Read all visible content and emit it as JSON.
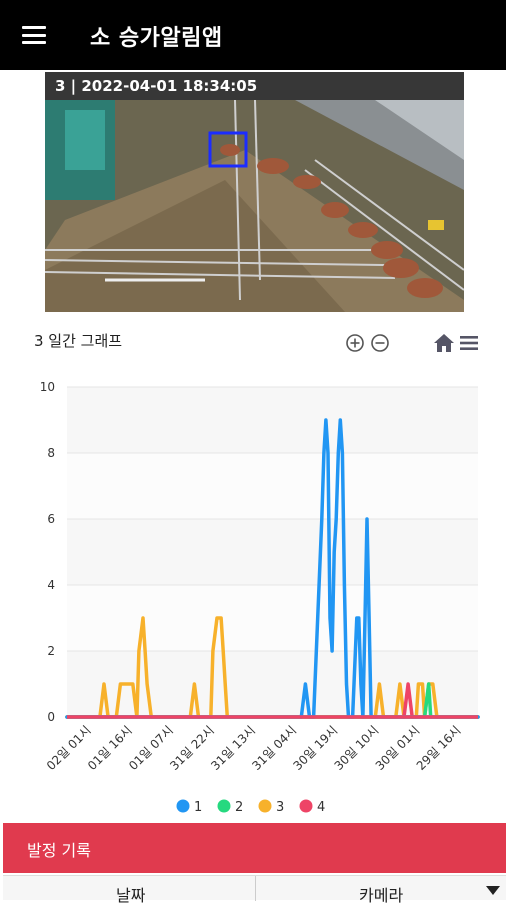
{
  "app": {
    "title": "소 승가알림앱"
  },
  "camera": {
    "header": "3 | 2022-04-01 18:34:05"
  },
  "graph": {
    "title": "3 일간 그래프"
  },
  "chart_data": {
    "type": "line",
    "title": "3 일간 그래프",
    "ylim": [
      0,
      10
    ],
    "yticks": [
      0,
      2,
      4,
      6,
      8,
      10
    ],
    "xticks": [
      "02일 01시",
      "01일 16시",
      "01일 07시",
      "31일 22시",
      "31일 13시",
      "31일 04시",
      "30일 19시",
      "30일 10시",
      "30일 01시",
      "29일 16시"
    ],
    "grid": true,
    "legend_position": "bottom",
    "series": [
      {
        "name": "1",
        "color": "#2196f3",
        "values": [
          [
            0,
            0
          ],
          [
            5.7,
            0
          ],
          [
            5.8,
            1
          ],
          [
            5.9,
            0
          ],
          [
            6.0,
            0
          ],
          [
            6.1,
            3
          ],
          [
            6.2,
            6
          ],
          [
            6.25,
            8
          ],
          [
            6.3,
            9
          ],
          [
            6.35,
            8
          ],
          [
            6.4,
            3
          ],
          [
            6.45,
            2
          ],
          [
            6.5,
            5
          ],
          [
            6.55,
            6
          ],
          [
            6.6,
            8
          ],
          [
            6.65,
            9
          ],
          [
            6.7,
            8
          ],
          [
            6.75,
            4
          ],
          [
            6.8,
            1
          ],
          [
            6.85,
            0
          ],
          [
            6.95,
            0
          ],
          [
            7.05,
            3
          ],
          [
            7.1,
            3
          ],
          [
            7.15,
            1
          ],
          [
            7.2,
            0
          ],
          [
            7.25,
            3
          ],
          [
            7.3,
            6
          ],
          [
            7.35,
            3
          ],
          [
            7.4,
            0
          ],
          [
            10,
            0
          ]
        ]
      },
      {
        "name": "2",
        "color": "#26d97f",
        "values": [
          [
            0,
            0
          ],
          [
            8.7,
            0
          ],
          [
            8.8,
            1
          ],
          [
            8.85,
            0
          ],
          [
            10,
            0
          ]
        ]
      },
      {
        "name": "3",
        "color": "#f7b12b",
        "values": [
          [
            0,
            0
          ],
          [
            0.8,
            0
          ],
          [
            0.9,
            1
          ],
          [
            1.0,
            0
          ],
          [
            1.2,
            0
          ],
          [
            1.3,
            1
          ],
          [
            1.6,
            1
          ],
          [
            1.7,
            0
          ],
          [
            1.75,
            2
          ],
          [
            1.85,
            3
          ],
          [
            1.9,
            2
          ],
          [
            1.95,
            1
          ],
          [
            2.05,
            0
          ],
          [
            3.0,
            0
          ],
          [
            3.1,
            1
          ],
          [
            3.2,
            0
          ],
          [
            3.5,
            0
          ],
          [
            3.55,
            2
          ],
          [
            3.65,
            3
          ],
          [
            3.75,
            3
          ],
          [
            3.8,
            2
          ],
          [
            3.85,
            1
          ],
          [
            3.9,
            0
          ],
          [
            7.5,
            0
          ],
          [
            7.6,
            1
          ],
          [
            7.7,
            0
          ],
          [
            8.0,
            0
          ],
          [
            8.1,
            1
          ],
          [
            8.2,
            0
          ],
          [
            8.5,
            0
          ],
          [
            8.55,
            1
          ],
          [
            8.65,
            1
          ],
          [
            8.7,
            0
          ],
          [
            8.8,
            1
          ],
          [
            8.9,
            1
          ],
          [
            9.0,
            0
          ],
          [
            10,
            0
          ]
        ]
      },
      {
        "name": "4",
        "color": "#ee4466",
        "values": [
          [
            0,
            0
          ],
          [
            8.2,
            0
          ],
          [
            8.3,
            1
          ],
          [
            8.4,
            0
          ],
          [
            10,
            0
          ]
        ]
      }
    ]
  },
  "record": {
    "title": "발정 기록"
  },
  "table": {
    "col_date": "날짜",
    "col_camera": "카메라"
  }
}
